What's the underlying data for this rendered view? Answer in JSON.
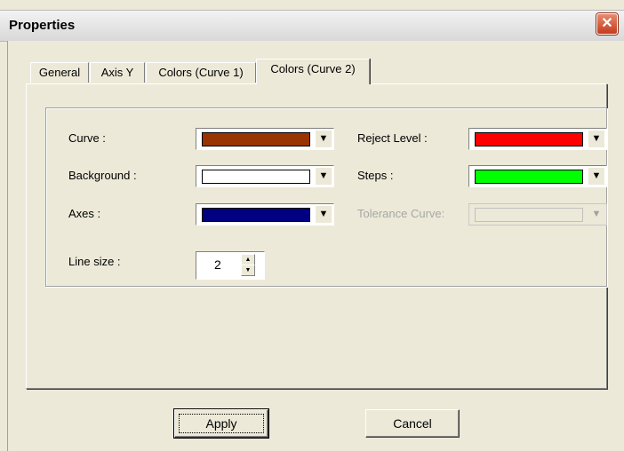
{
  "window": {
    "title": "Properties",
    "close_glyph": "✕"
  },
  "tabs": [
    {
      "label": "General"
    },
    {
      "label": "Axis Y"
    },
    {
      "label": "Colors (Curve 1)"
    },
    {
      "label": "Colors (Curve 2)"
    }
  ],
  "active_tab": "Colors (Curve 2)",
  "fields": {
    "curve": {
      "label": "Curve :",
      "color": "#993300"
    },
    "background": {
      "label": "Background :",
      "color": "#ffffff"
    },
    "axes": {
      "label": "Axes :",
      "color": "#000080"
    },
    "reject_level": {
      "label": "Reject Level :",
      "color": "#ff0000"
    },
    "steps": {
      "label": "Steps :",
      "color": "#00ff00"
    },
    "tolerance_curve": {
      "label": "Tolerance Curve:",
      "color": "#ece9d8",
      "disabled": true
    },
    "line_size": {
      "label": "Line size :",
      "value": "2"
    }
  },
  "buttons": {
    "apply": "Apply",
    "cancel": "Cancel"
  },
  "icons": {
    "dropdown": "chevron-down-icon",
    "close": "close-icon"
  }
}
